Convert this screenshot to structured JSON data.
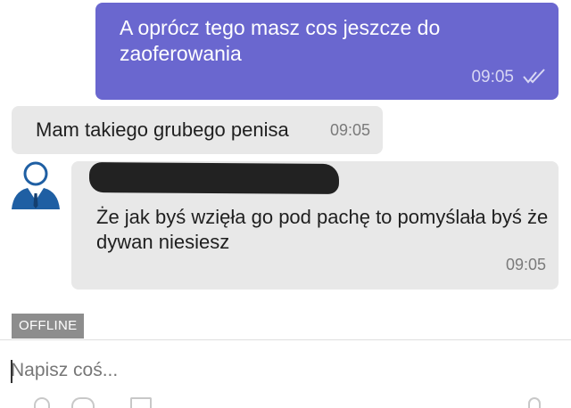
{
  "messages": [
    {
      "direction": "outgoing",
      "text": "A oprócz tego masz cos jeszcze do zaoferowania",
      "time": "09:05",
      "status_icon": "double-check-icon"
    },
    {
      "direction": "incoming",
      "text": "Mam takiego grubego penisa",
      "time": "09:05"
    },
    {
      "direction": "incoming",
      "text": "Że jak byś wzięła go pod pachę to pomyślała byś że dywan niesiesz",
      "time": "09:05",
      "avatar_icon": "user-avatar-icon"
    }
  ],
  "status": {
    "badge": "OFFLINE"
  },
  "composer": {
    "placeholder": "Napisz coś..."
  },
  "colors": {
    "outgoing_bubble": "#6a67cf",
    "incoming_bubble": "#e8e8e8",
    "offline_badge": "#8d8d8d"
  }
}
